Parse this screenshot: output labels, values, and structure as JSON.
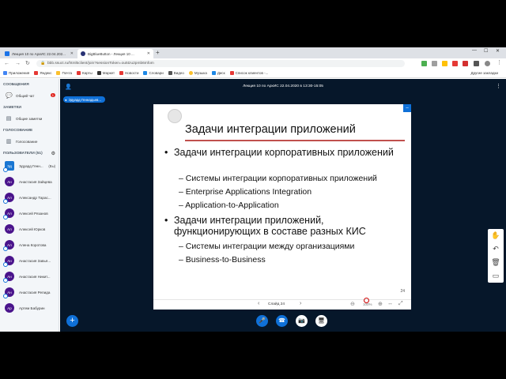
{
  "browser": {
    "tabs": [
      {
        "title": "Лекция 10 по АрхИС 22.04.202..."
      },
      {
        "title": "BigBlueButton - Лекция 10 ..."
      }
    ],
    "url": "bbb.ssuct.ru/html5client/join?sessionToken=ou5tzu2pmb6mfom",
    "bookmarks": [
      "Приложения",
      "Яндекс",
      "Почта",
      "Карты",
      "Маркет",
      "Новости",
      "Словари",
      "Видео",
      "Музыка",
      "Диск",
      "Список клиентов -..."
    ],
    "other_bookmarks": "Другие закладки",
    "colors": {
      "accent": "#0f70d7",
      "panel": "#06172a"
    }
  },
  "sidebar": {
    "messages_title": "СООБЩЕНИЯ",
    "public_chat": "Общий чат",
    "chat_badge": "1",
    "notes_title": "ЗАМЕТКИ",
    "shared_notes": "Общие заметки",
    "polling_title": "ГОЛОСОВАНИЕ",
    "polling": "Голосование",
    "users_title": "ПОЛЬЗОВАТЕЛИ (51)",
    "you_label": "(Вы)",
    "users": [
      {
        "initials": "Эд",
        "name": "Эдуард Генн..."
      },
      {
        "initials": "Ан",
        "name": "Анастасия Зайцева"
      },
      {
        "initials": "Ал",
        "name": "Александр Тарас..."
      },
      {
        "initials": "Ал",
        "name": "Алексей Рязанов"
      },
      {
        "initials": "Ал",
        "name": "Алексей Юрков"
      },
      {
        "initials": "Ал",
        "name": "Алена Коротова"
      },
      {
        "initials": "Ан",
        "name": "Анастасия Завья..."
      },
      {
        "initials": "Ан",
        "name": "Анастасия Никит..."
      },
      {
        "initials": "Ан",
        "name": "Анастасия Репида"
      },
      {
        "initials": "Ар",
        "name": "Артем Бабурин"
      }
    ]
  },
  "main": {
    "meeting_title": "Лекция 10 по АрхИС 22.04.2020 в 13:30-15:05",
    "presenter": "Эдуард Геннадьев..."
  },
  "slide": {
    "title": "Задачи интеграции приложений",
    "bullets": [
      {
        "text": "Задачи интеграции корпоративных приложений",
        "subs": [
          "Системы интеграции корпоративных приложений",
          "Enterprise Applications Integration",
          "Application-to-Application"
        ]
      },
      {
        "text": "Задачи интеграции приложений, функционирующих в составе разных КИС",
        "subs": [
          "Системы интеграции между организациями",
          "Business-to-Business"
        ]
      }
    ],
    "page_number": "24",
    "controls_label": "Слайд 24",
    "zoom": "100%"
  }
}
